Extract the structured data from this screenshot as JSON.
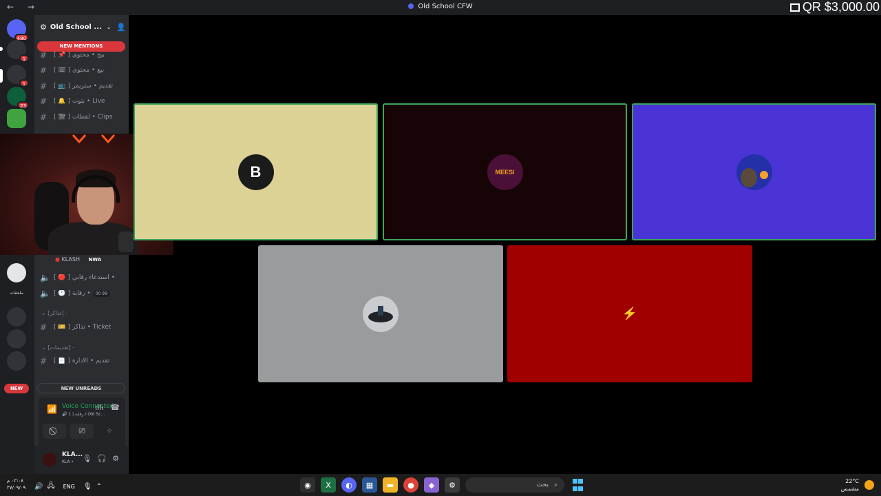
{
  "titlebar": {
    "nav": "← →",
    "title": "Old School CFW",
    "overlay": "QR $3,000.00"
  },
  "rail": {
    "servers": [
      {
        "name": "discord-home",
        "badge": "480",
        "color": "#5865f2"
      },
      {
        "name": "server-2",
        "badge": "1",
        "color": "#3d3f45"
      },
      {
        "name": "server-3",
        "badge": "1",
        "color": "#3d3f45"
      },
      {
        "name": "server-4",
        "badge": "23",
        "color": "#0d5f3a"
      },
      {
        "name": "server-creeper",
        "badge": "",
        "color": "#3fa33f"
      }
    ],
    "new_pill": "NEW",
    "folder_text": "ملحقات"
  },
  "sidebar": {
    "server_name": "Old School ...",
    "new_mentions": "NEW MENTIONS",
    "new_unreads": "NEW UNREADS",
    "channels_top": [
      {
        "label": "[ 📌 ] بيج • محتوى",
        "color": "#da373c"
      },
      {
        "label": "[ 🗓 ] بيع • محتوى",
        "color": "#5865f2"
      },
      {
        "label": "[ 📺 ] تقديم • ستريمر",
        "color": "#7289da"
      },
      {
        "label": "[ 🔔 ] بثوت • Live",
        "color": "#f0b232"
      },
      {
        "label": "[ 🎬 ] لقطات • Clips",
        "color": "#7a5cd6"
      }
    ],
    "voice_user": "KLASH",
    "voice_user_tag": "NWA",
    "voice_channels": [
      {
        "label": "[ 🔴 ] استدعاء رقابي •",
        "counter": ""
      },
      {
        "label": "[ 🕐 ] رقابة •",
        "counter": "00  99"
      }
    ],
    "category_1": "⌄ [تذاكر] -",
    "ticket_channel": "[ 🎫 ] تذاكر • Ticket",
    "category_2": "⌄ [تقديمات] -",
    "admin_channel": "[ 📄 ] تقديم • الادارة"
  },
  "voice_panel": {
    "status": "Voice Connected",
    "location": "🔊 1 | رقابة / Old Sc..."
  },
  "user_panel": {
    "name": "KLA...",
    "status": "KLA •"
  },
  "tiles": [
    {
      "bg": "#ddd295",
      "speaking": true,
      "avatar_bg": "#1b1b1b",
      "avatar_text": "B"
    },
    {
      "bg": "#170406",
      "speaking": true,
      "avatar_bg": "#4a1038",
      "avatar_text": "MEESI"
    },
    {
      "bg": "#4a34d6",
      "speaking": true,
      "avatar_bg": "#2430a8",
      "avatar_text": ""
    },
    {
      "bg": "#999b9d",
      "speaking": false,
      "avatar_bg": "#c9cdd0",
      "avatar_text": ""
    },
    {
      "bg": "#a10000",
      "speaking": false,
      "avatar_bg": "#a10000",
      "avatar_text": "⚡"
    }
  ],
  "taskbar": {
    "time": "٠٢:٠٨ م",
    "date": "٢٧/٠٩/٠٩",
    "language": "ENG",
    "search_placeholder": "بحث",
    "temperature": "22°C",
    "weather": "مشمس"
  }
}
